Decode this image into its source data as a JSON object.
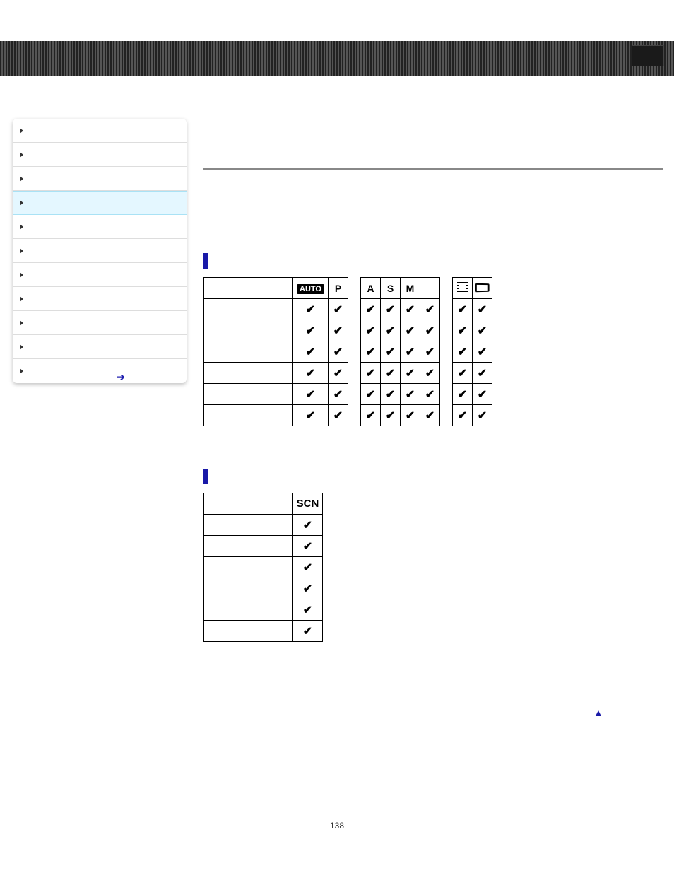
{
  "page_number": "138",
  "sidebar": {
    "items": [
      {
        "label": "",
        "selected": false
      },
      {
        "label": "",
        "selected": false
      },
      {
        "label": "",
        "selected": false
      },
      {
        "label": "",
        "selected": true
      },
      {
        "label": "",
        "selected": false
      },
      {
        "label": "",
        "selected": false
      },
      {
        "label": "",
        "selected": false
      },
      {
        "label": "",
        "selected": false
      },
      {
        "label": "",
        "selected": false
      },
      {
        "label": "",
        "selected": false
      },
      {
        "label": "",
        "selected": false
      }
    ]
  },
  "sections": {
    "rec_mode": "",
    "scene_mode": ""
  },
  "columns": {
    "auto": "AUTO",
    "p": "P",
    "a": "A",
    "s": "S",
    "m": "M",
    "blank": "",
    "film": "film-icon",
    "pano": "panorama-icon",
    "scn": "SCN"
  },
  "chart_data": [
    {
      "type": "table",
      "title": "Recording mode availability",
      "columns": [
        "",
        "AUTO",
        "P",
        "A",
        "S",
        "M",
        "",
        "Movie",
        "Panorama"
      ],
      "rows": [
        {
          "label": "",
          "values": [
            true,
            true,
            true,
            true,
            true,
            true,
            true,
            true
          ]
        },
        {
          "label": "",
          "values": [
            true,
            true,
            true,
            true,
            true,
            true,
            true,
            true
          ]
        },
        {
          "label": "",
          "values": [
            true,
            true,
            true,
            true,
            true,
            true,
            true,
            true
          ]
        },
        {
          "label": "",
          "values": [
            true,
            true,
            true,
            true,
            true,
            true,
            true,
            true
          ]
        },
        {
          "label": "",
          "values": [
            true,
            true,
            true,
            true,
            true,
            true,
            true,
            true
          ]
        },
        {
          "label": "",
          "values": [
            true,
            true,
            true,
            true,
            true,
            true,
            true,
            true
          ]
        }
      ]
    },
    {
      "type": "table",
      "title": "Scene mode availability",
      "columns": [
        "",
        "SCN"
      ],
      "rows": [
        {
          "label": "",
          "values": [
            true
          ]
        },
        {
          "label": "",
          "values": [
            true
          ]
        },
        {
          "label": "",
          "values": [
            true
          ]
        },
        {
          "label": "",
          "values": [
            true
          ]
        },
        {
          "label": "",
          "values": [
            true
          ]
        },
        {
          "label": "",
          "values": [
            true
          ]
        }
      ]
    }
  ]
}
